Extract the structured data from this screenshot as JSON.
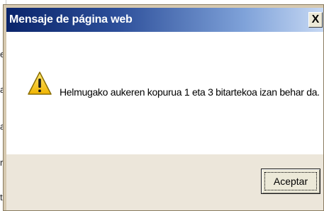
{
  "background_page": {
    "visible_chars": [
      "e",
      "a",
      "a",
      "r",
      "t"
    ]
  },
  "dialog": {
    "title": "Mensaje de página web",
    "close_label": "X",
    "icon": "warning-triangle-icon",
    "message": "Helmugako aukeren kopurua 1 eta 3 bitartekoa izan behar da.",
    "ok_label": "Aceptar"
  },
  "colors": {
    "title_gradient_start": "#0a246a",
    "title_gradient_end": "#c6d8f3",
    "title_text": "#ffffff",
    "warning_fill": "#f5c518",
    "warning_stroke": "#8a6d00"
  }
}
